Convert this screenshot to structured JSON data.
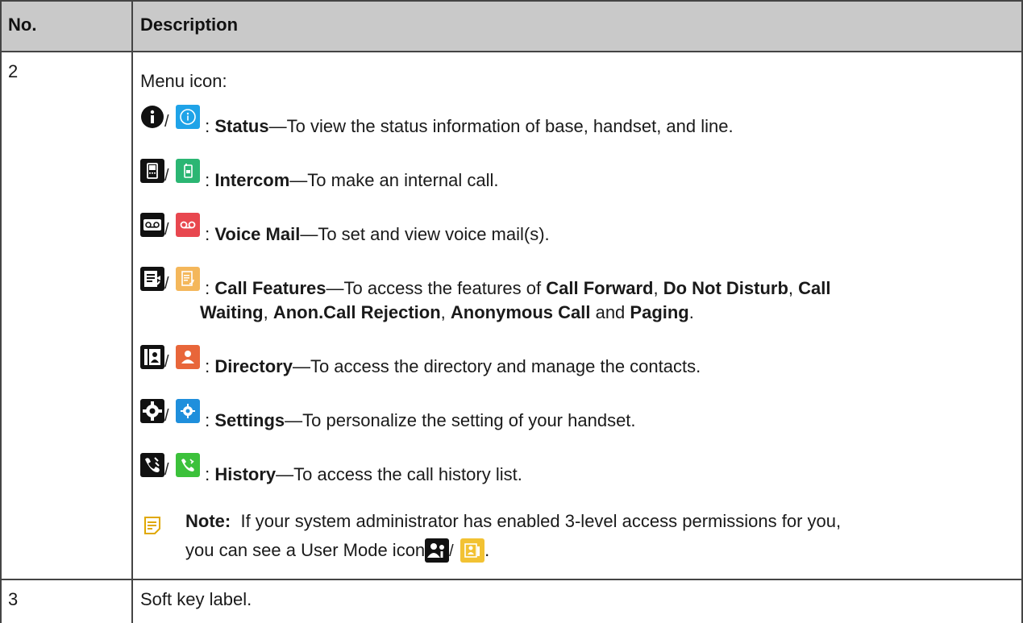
{
  "header": {
    "col_no": "No.",
    "col_desc": "Description"
  },
  "row2": {
    "no": "2",
    "intro": "Menu icon:",
    "items": [
      {
        "icon_dark": "status-dark-icon",
        "icon_color": "status-color-icon",
        "title": "Status",
        "desc": "—To view the status information of base, handset, and line."
      },
      {
        "icon_dark": "intercom-dark-icon",
        "icon_color": "intercom-color-icon",
        "title": "Intercom",
        "desc": "—To make an internal call."
      },
      {
        "icon_dark": "voicemail-dark-icon",
        "icon_color": "voicemail-color-icon",
        "title": "Voice Mail",
        "desc": "—To set and view voice mail(s)."
      },
      {
        "icon_dark": "callfeatures-dark-icon",
        "icon_color": "callfeatures-color-icon",
        "title": "Call Features",
        "desc": "—To access the features of "
      },
      {
        "icon_dark": "directory-dark-icon",
        "icon_color": "directory-color-icon",
        "title": "Directory",
        "desc": "—To access the directory and manage the contacts."
      },
      {
        "icon_dark": "settings-dark-icon",
        "icon_color": "settings-color-icon",
        "title": "Settings",
        "desc": "—To personalize the setting of your handset."
      },
      {
        "icon_dark": "history-dark-icon",
        "icon_color": "history-color-icon",
        "title": "History",
        "desc": "—To access the call history list."
      }
    ],
    "cf_features": [
      "Call Forward",
      "Do Not Disturb",
      "Call",
      "Waiting",
      "Anon.Call Rejection",
      "Anonymous Call",
      "Paging"
    ],
    "cf_separators": [
      ", ",
      ", ",
      "",
      ", ",
      ", ",
      " and ",
      "."
    ],
    "separator": "/",
    "colon": ": ",
    "note": {
      "label": "Note:",
      "line1": "If your system administrator has enabled 3-level access permissions for you,",
      "line2": "you can see a User Mode icon ",
      "end": "."
    }
  },
  "row3": {
    "no": "3",
    "desc": "Soft key label."
  },
  "colors": {
    "header_bg": "#c9c9c9",
    "status_blue": "#1fa3e8",
    "intercom_green": "#2bb673",
    "voicemail_red": "#e8474f",
    "callfeatures_orange": "#f4b75b",
    "directory_orange": "#e8663a",
    "settings_blue": "#1f8fdc",
    "history_green": "#3cc13b",
    "usermode_yellow": "#f2c233"
  }
}
